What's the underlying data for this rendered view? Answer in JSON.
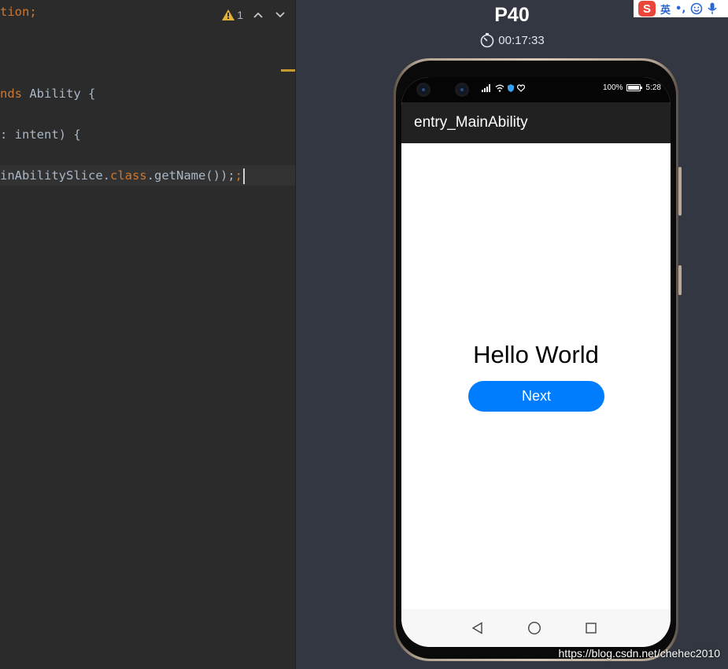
{
  "editor": {
    "warning_count": "1",
    "lines": [
      {
        "a": "tion",
        "b": ";",
        "c": ""
      },
      {
        "a": "nds",
        "b": " Ability {",
        "c": ""
      },
      {
        "a": ": intent) {",
        "b": "",
        "c": ""
      },
      {
        "a": "inAbilitySlice.",
        "b": "class",
        "c": ".getName());"
      }
    ]
  },
  "simulator": {
    "device_name": "P40",
    "timer": "00:17:33",
    "ime": {
      "logo": "S",
      "lang": "英",
      "punct": "•,"
    }
  },
  "phone": {
    "status": {
      "battery": "100%",
      "time": "5:28"
    },
    "app_title": "entry_MainAbility",
    "hello_text": "Hello World",
    "next_button": "Next"
  },
  "watermark": "https://blog.csdn.net/chehec2010",
  "colors": {
    "editor_bg": "#2b2b2b",
    "keyword": "#cc7832",
    "sim_bg": "#323741",
    "button": "#007dff"
  }
}
